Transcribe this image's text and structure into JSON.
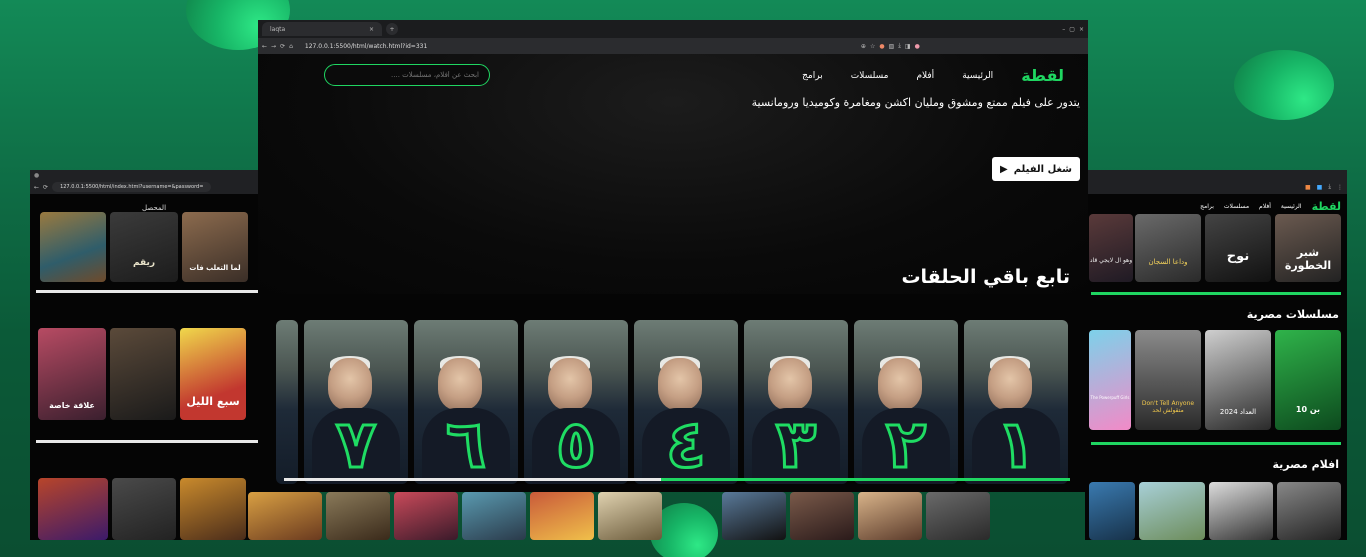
{
  "colors": {
    "accent": "#1fd661",
    "background": "#050505"
  },
  "main_browser": {
    "tab_title": "laqta",
    "url": "127.0.0.1:5500/html/watch.html?id=331",
    "nav": {
      "logo": "لقطة",
      "home": "الرئيسية",
      "movies": "أفلام",
      "series": "مسلسلات",
      "programs": "برامج"
    },
    "search_placeholder": "ابحث عن أفلام، مسلسلات ....",
    "description": "يتدور على فيلم ممتع ومشوق ومليان اكشن ومغامرة وكوميديا ورومانسية",
    "play_button": "شغل الفيلم",
    "episodes_title": "تابع باقي الحلقات",
    "episodes": [
      "١",
      "٢",
      "٣",
      "٤",
      "٥",
      "٦",
      "٧"
    ],
    "progress": 0.52
  },
  "left_browser": {
    "url": "127.0.0.1:5500/html/index.html?username=&password=",
    "top_label": "المحصل",
    "poster_titles": [
      "لما التعلب فات",
      "ريقم",
      "سبع الليل",
      "علاقة خاصة"
    ]
  },
  "right_browser": {
    "nav": {
      "logo": "لقطة",
      "home": "الرئيسية",
      "movies": "أفلام",
      "series": "مسلسلات",
      "programs": "برامج"
    },
    "section_series": "مسلسلات مصرية",
    "section_movies": "افلام مصرية",
    "poster_titles": [
      "شبر الخطورة",
      "نوح",
      "وداعا السجان",
      "وهو ال لايجي قاد",
      "بن 10",
      "العداد 2024",
      "Don't Tell Anyone متقولش لحد",
      "The Powerpuff Girls"
    ]
  }
}
